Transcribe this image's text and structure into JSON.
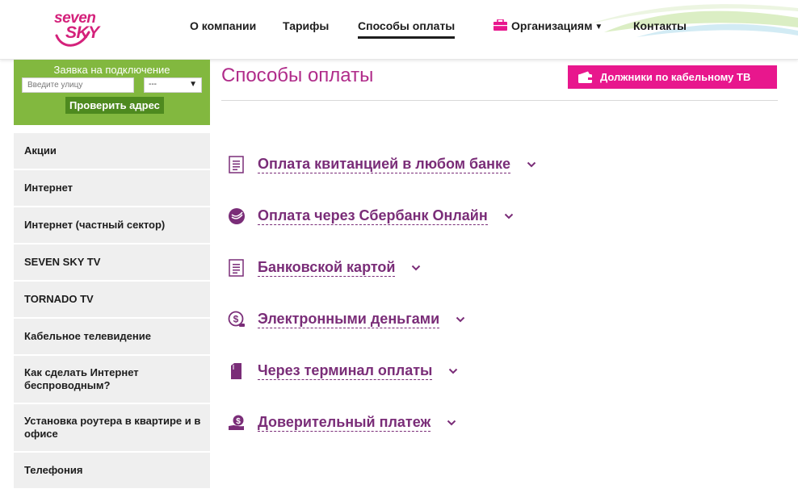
{
  "logo": {
    "line1": "seven",
    "line2": "SKY"
  },
  "nav": {
    "about": "О компании",
    "tariffs": "Тарифы",
    "payment": "Способы оплаты",
    "organizations": "Организациям",
    "contacts": "Контакты"
  },
  "signup": {
    "title": "Заявка на подключение",
    "street_placeholder": "Введите улицу",
    "house_value": "---",
    "check_button": "Проверить адрес"
  },
  "sidebar": {
    "items": [
      {
        "label": "Акции"
      },
      {
        "label": "Интернет"
      },
      {
        "label": "Интернет (частный сектор)"
      },
      {
        "label": "SEVEN SKY TV"
      },
      {
        "label": "TORNADO TV"
      },
      {
        "label": "Кабельное телевидение"
      },
      {
        "label": "Как сделать Интернет беспроводным?"
      },
      {
        "label": "Установка роутера в квартире и в офисе"
      },
      {
        "label": "Телефония"
      }
    ]
  },
  "main": {
    "title": "Способы оплаты",
    "debtors_button": "Должники по кабельному ТВ",
    "payment_methods": [
      {
        "label": "Оплата квитанцией в любом банке",
        "icon": "receipt-icon"
      },
      {
        "label": "Оплата через Сбербанк Онлайн",
        "icon": "sberbank-icon"
      },
      {
        "label": "Банковской картой",
        "icon": "receipt-icon"
      },
      {
        "label": "Электронными деньгами",
        "icon": "e-money-icon"
      },
      {
        "label": "Через терминал оплаты",
        "icon": "terminal-icon"
      },
      {
        "label": "Доверительный платеж",
        "icon": "trust-payment-icon"
      }
    ]
  },
  "colors": {
    "brand_pink": "#e8178d",
    "title_magenta": "#b02c8a",
    "link_purple": "#7a2d78",
    "signup_green": "#82b83f",
    "button_green": "#4e8a1f"
  }
}
